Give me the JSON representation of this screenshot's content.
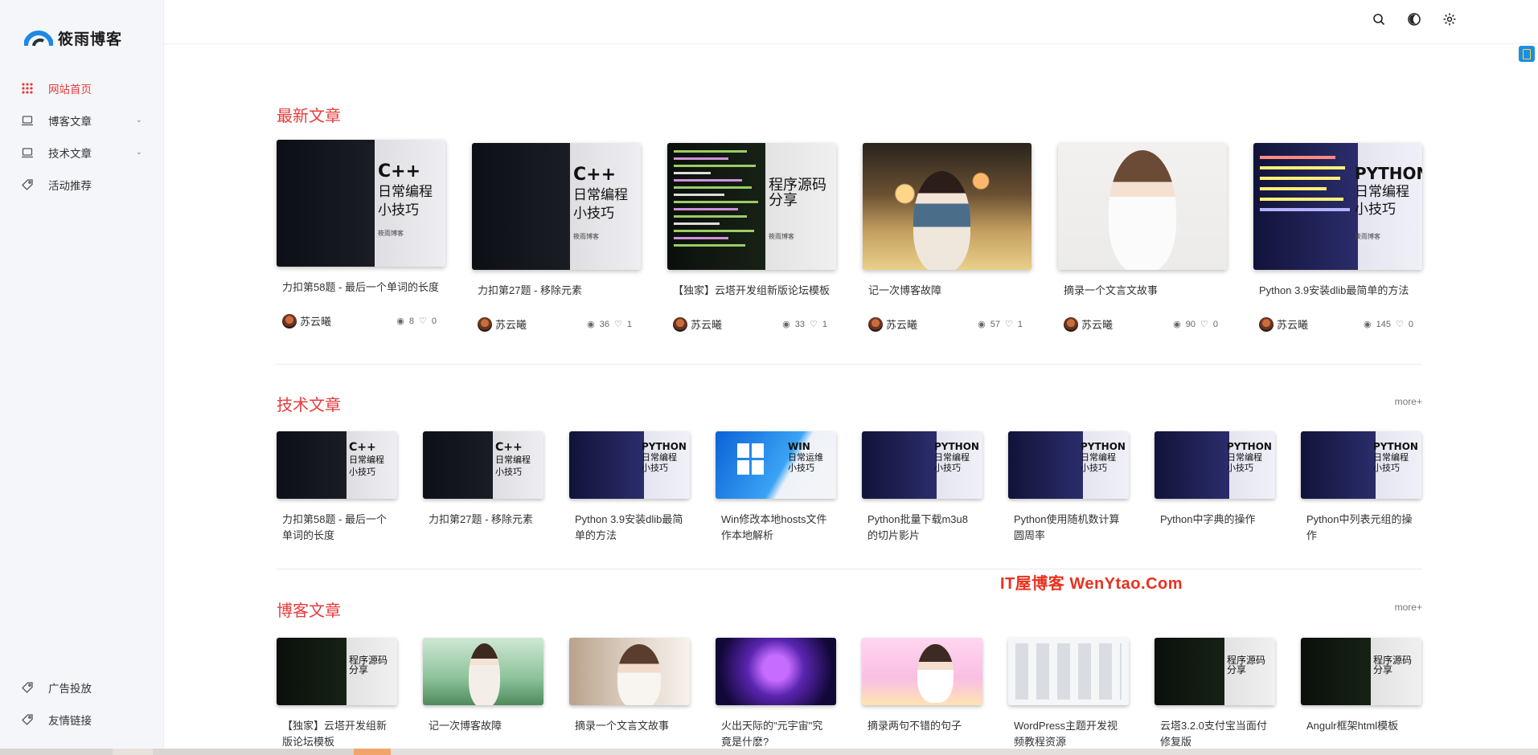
{
  "brand": {
    "name": "筱雨博客"
  },
  "sidebar": {
    "items": [
      {
        "label": "网站首页",
        "icon": "grid-icon",
        "active": true
      },
      {
        "label": "博客文章",
        "icon": "laptop-icon",
        "has_children": true
      },
      {
        "label": "技术文章",
        "icon": "laptop-icon",
        "has_children": true
      },
      {
        "label": "活动推荐",
        "icon": "tag-icon"
      }
    ],
    "bottom_items": [
      {
        "label": "广告投放",
        "icon": "tag-icon"
      },
      {
        "label": "友情链接",
        "icon": "tag-icon"
      }
    ]
  },
  "header": {
    "icons": [
      "search-icon",
      "theme-toggle-icon",
      "settings-icon"
    ]
  },
  "sections": {
    "latest": {
      "title": "最新文章",
      "cards": [
        {
          "title": "力扣第58题 - 最后一个单词的长度",
          "author": "苏云曦",
          "views": "8",
          "likes": "0",
          "thumb": "code-cpp",
          "overlay": "C++\n日常编程\n小技巧",
          "overlay_sub": "筱雨博客"
        },
        {
          "title": "力扣第27题 - 移除元素",
          "author": "苏云曦",
          "views": "36",
          "likes": "1",
          "thumb": "code-cpp",
          "overlay": "C++\n日常编程\n小技巧",
          "overlay_sub": "筱雨博客"
        },
        {
          "title": "【独家】云塔开发组新版论坛模板",
          "author": "苏云曦",
          "views": "33",
          "likes": "1",
          "thumb": "code-green",
          "overlay": "程序源码\n分享",
          "overlay_sub": "筱雨博客"
        },
        {
          "title": "记一次博客故障",
          "author": "苏云曦",
          "views": "57",
          "likes": "1",
          "thumb": "girl-night"
        },
        {
          "title": "摘录一个文言文故事",
          "author": "苏云曦",
          "views": "90",
          "likes": "0",
          "thumb": "girl-white"
        },
        {
          "title": "Python 3.9安装dlib最简单的方法",
          "author": "苏云曦",
          "views": "145",
          "likes": "0",
          "thumb": "code-python",
          "overlay": "PYTHON\n日常编程\n小技巧",
          "overlay_sub": "筱雨博客"
        }
      ]
    },
    "tech": {
      "title": "技术文章",
      "more": "more+",
      "cards": [
        {
          "title": "力扣第58题 - 最后一个单词的长度",
          "thumb": "code-cpp",
          "overlay": "C++\n日常编程\n小技巧"
        },
        {
          "title": "力扣第27题 - 移除元素",
          "thumb": "code-cpp",
          "overlay": "C++\n日常编程\n小技巧"
        },
        {
          "title": "Python 3.9安装dlib最简单的方法",
          "thumb": "code-python",
          "overlay": "PYTHON\n日常编程\n小技巧"
        },
        {
          "title": "Win修改本地hosts文件作本地解析",
          "thumb": "win",
          "overlay": "WIN\n日常运维\n小技巧"
        },
        {
          "title": "Python批量下载m3u8的切片影片",
          "thumb": "code-python",
          "overlay": "PYTHON\n日常编程\n小技巧"
        },
        {
          "title": "Python使用随机数计算圆周率",
          "thumb": "code-python",
          "overlay": "PYTHON\n日常编程\n小技巧"
        },
        {
          "title": "Python中字典的操作",
          "thumb": "code-python",
          "overlay": "PYTHON\n日常编程\n小技巧"
        },
        {
          "title": "Python中列表元组的操作",
          "thumb": "code-python",
          "overlay": "PYTHON\n日常编程\n小技巧"
        }
      ]
    },
    "blog": {
      "title": "博客文章",
      "more": "more+",
      "cards": [
        {
          "title": "【独家】云塔开发组新版论坛模板",
          "thumb": "code-green",
          "overlay": "程序源码\n分享"
        },
        {
          "title": "记一次博客故障",
          "thumb": "girl-garden"
        },
        {
          "title": "摘录一个文言文故事",
          "thumb": "girl-cup"
        },
        {
          "title": "火出天际的\"元宇宙\"究竟是什麽?",
          "thumb": "vr"
        },
        {
          "title": "摘录两句不错的句子",
          "thumb": "girl-pink"
        },
        {
          "title": "WordPress主题开发视频教程资源",
          "thumb": "wp"
        },
        {
          "title": "云塔3.2.0支付宝当面付修复版",
          "thumb": "code-green",
          "overlay": "程序源码\n分享"
        },
        {
          "title": "Angulr框架html模板",
          "thumb": "code-green",
          "overlay": "程序源码\n分享"
        }
      ]
    }
  },
  "watermark": "IT屋博客 WenYtao.Com",
  "colors": {
    "accent": "#e83a3a",
    "sidebar_bg": "#f5f6fa"
  }
}
